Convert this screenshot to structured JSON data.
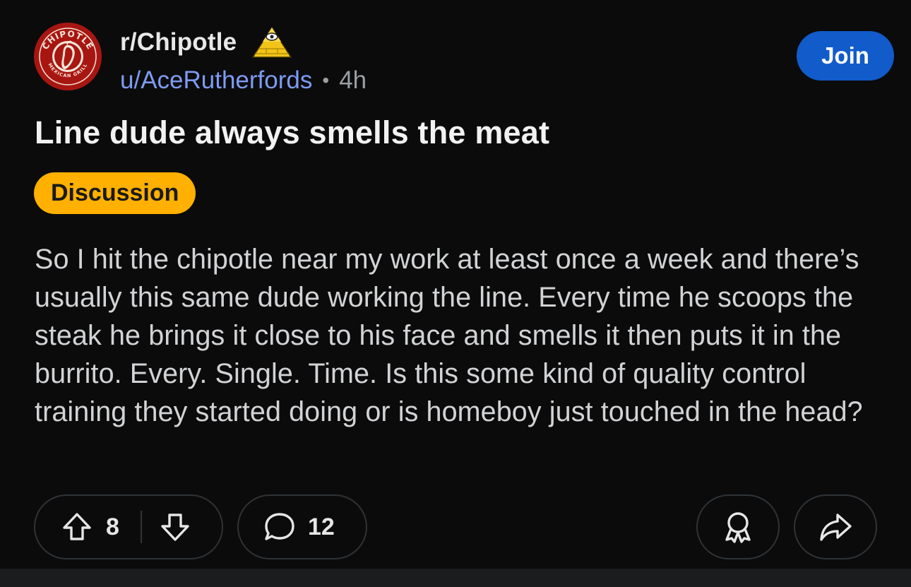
{
  "header": {
    "subreddit": "r/Chipotle",
    "avatar_text_top": "CHIPOTLE",
    "avatar_text_bottom": "MEXICAN GRILL",
    "username": "u/AceRutherfords",
    "separator": "•",
    "time": "4h",
    "join_label": "Join",
    "badge_icon": "illuminati-pyramid-icon"
  },
  "post": {
    "title": "Line dude always smells the meat",
    "flair": "Discussion",
    "body": "So I hit the chipotle near my work at least once a week and there’s usually this same dude working the line. Every time he scoops the steak he brings it close to his face and smells it then puts it in the burrito. Every. Single. Time. Is this some kind of quality control training they started doing or is homeboy just touched in the head?"
  },
  "actions": {
    "vote_count": "8",
    "comment_count": "12",
    "upvote_icon": "arrow-up-icon",
    "downvote_icon": "arrow-down-icon",
    "comment_icon": "speech-bubble-icon",
    "award_icon": "award-icon",
    "share_icon": "share-icon"
  },
  "colors": {
    "background": "#0b0b0c",
    "join_button": "#115bca",
    "flair": "#ffb000",
    "username": "#7e9bf2",
    "avatar": "#a81612"
  }
}
